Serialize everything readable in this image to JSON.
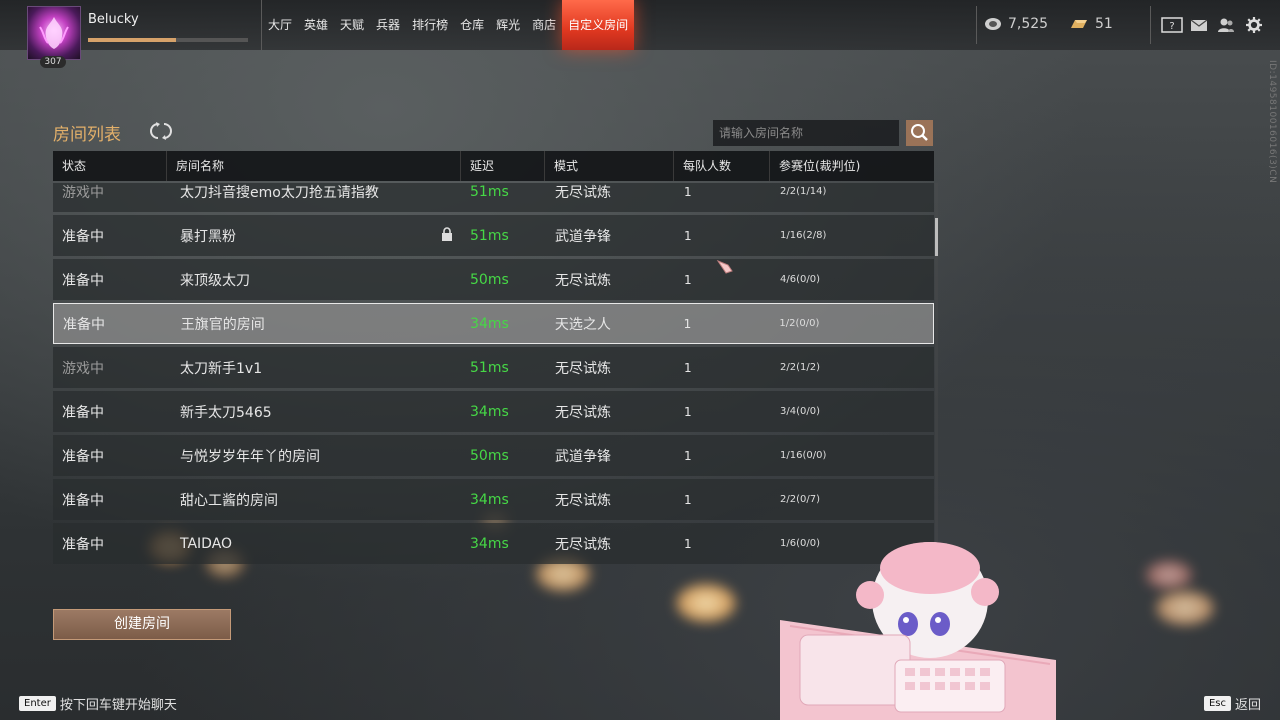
{
  "player": {
    "name": "Belucky",
    "level": "307",
    "xp_fraction": 0.55
  },
  "nav": {
    "items": [
      {
        "label": "大厅",
        "active": false
      },
      {
        "label": "英雄",
        "active": false
      },
      {
        "label": "天赋",
        "active": false
      },
      {
        "label": "兵器",
        "active": false
      },
      {
        "label": "排行榜",
        "active": false
      },
      {
        "label": "仓库",
        "active": false
      },
      {
        "label": "辉光",
        "active": false
      },
      {
        "label": "商店",
        "active": false
      },
      {
        "label": "自定义房间",
        "active": true
      }
    ]
  },
  "currency": {
    "coins": "7,525",
    "gold": "51"
  },
  "side_id": "ID:1495810016016(3)CN",
  "room_list": {
    "title": "房间列表",
    "search_placeholder": "请输入房间名称",
    "headers": {
      "status": "状态",
      "name": "房间名称",
      "latency": "延迟",
      "mode": "模式",
      "per_team": "每队人数",
      "slots": "参赛位(裁判位)"
    },
    "rows": [
      {
        "status": "游戏中",
        "name": "太刀抖音搜emo太刀抢五请指教",
        "latency": "51ms",
        "mode": "无尽试炼",
        "per_team": "1",
        "slots": "2/2(1/14)",
        "locked": false,
        "playing": true
      },
      {
        "status": "准备中",
        "name": "暴打黑粉",
        "latency": "51ms",
        "mode": "武道争锋",
        "per_team": "1",
        "slots": "1/16(2/8)",
        "locked": true,
        "playing": false
      },
      {
        "status": "准备中",
        "name": "来顶级太刀",
        "latency": "50ms",
        "mode": "无尽试炼",
        "per_team": "1",
        "slots": "4/6(0/0)",
        "locked": false,
        "playing": false
      },
      {
        "status": "准备中",
        "name": "王旗官的房间",
        "latency": "34ms",
        "mode": "天选之人",
        "per_team": "1",
        "slots": "1/2(0/0)",
        "locked": false,
        "playing": false,
        "selected": true
      },
      {
        "status": "游戏中",
        "name": "太刀新手1v1",
        "latency": "51ms",
        "mode": "无尽试炼",
        "per_team": "1",
        "slots": "2/2(1/2)",
        "locked": false,
        "playing": true
      },
      {
        "status": "准备中",
        "name": "新手太刀5465",
        "latency": "34ms",
        "mode": "无尽试炼",
        "per_team": "1",
        "slots": "3/4(0/0)",
        "locked": false,
        "playing": false
      },
      {
        "status": "准备中",
        "name": "与悦岁岁年年丫的房间",
        "latency": "50ms",
        "mode": "武道争锋",
        "per_team": "1",
        "slots": "1/16(0/0)",
        "locked": false,
        "playing": false
      },
      {
        "status": "准备中",
        "name": "甜心工酱的房间",
        "latency": "34ms",
        "mode": "无尽试炼",
        "per_team": "1",
        "slots": "2/2(0/7)",
        "locked": false,
        "playing": false
      },
      {
        "status": "准备中",
        "name": "TAIDAO",
        "latency": "34ms",
        "mode": "无尽试炼",
        "per_team": "1",
        "slots": "1/6(0/0)",
        "locked": false,
        "playing": false
      }
    ],
    "create_button": "创建房间"
  },
  "footer": {
    "chat_key": "Enter",
    "chat_hint": "按下回车键开始聊天",
    "back_key": "Esc",
    "back_label": "返回"
  },
  "colors": {
    "accent_nav": "#e03820",
    "title_gold": "#e3b06a",
    "latency_green": "#46d846",
    "button_brown": "#8c6a54"
  }
}
